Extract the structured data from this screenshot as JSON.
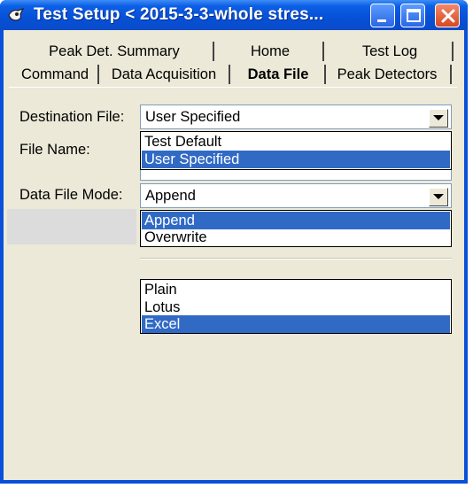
{
  "window": {
    "title": "Test Setup < 2015-3-3-whole stres...",
    "colors": {
      "titlebar": "#0650d6",
      "close_button": "#d9471f",
      "face": "#ece9d8",
      "selection": "#316ac5"
    }
  },
  "tabs": {
    "row1": [
      "Peak Det. Summary",
      "Home",
      "Test Log"
    ],
    "row2": [
      "Command",
      "Data Acquisition",
      "Data File",
      "Peak Detectors"
    ],
    "active": "Data File"
  },
  "form": {
    "destination_label": "Destination File:",
    "destination_value": "User Specified",
    "destination_options": [
      "Test Default",
      "User Specified"
    ],
    "destination_selected": "User Specified",
    "file_name_label": "File Name:",
    "data_file_mode_label": "Data File Mode:",
    "data_file_mode_value": "Append",
    "mode_options": [
      "Append",
      "Overwrite"
    ],
    "mode_selected": "Append",
    "format_options": [
      "Plain",
      "Lotus",
      "Excel"
    ],
    "format_selected": "Excel"
  }
}
